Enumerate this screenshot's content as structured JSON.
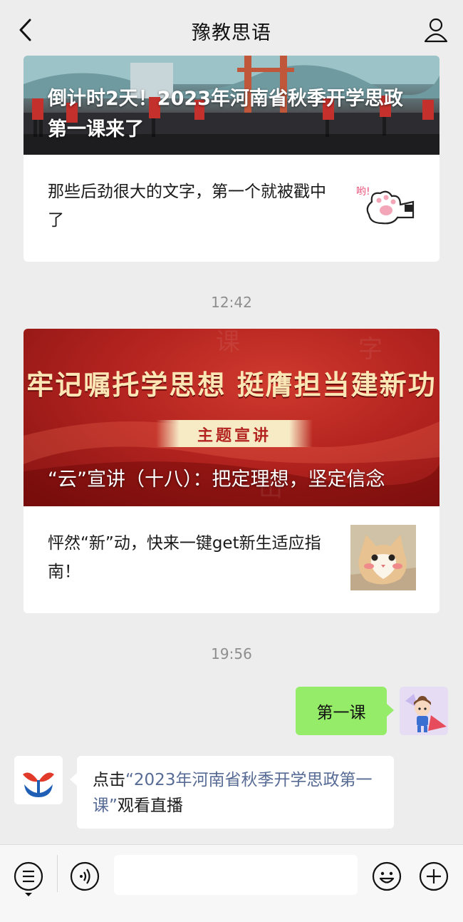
{
  "header": {
    "title": "豫教思语"
  },
  "articles": [
    {
      "cover_title": "倒计时2天！2023年河南省秋季开学思政第一课来了",
      "item_text": "那些后劲很大的文字，第一个就被戳中了"
    },
    {
      "cover_slogan": "牢记嘱托学思想 挺膺担当建新功",
      "cover_ribbon": "主题宣讲",
      "cover_title": "“云”宣讲（十八）：把定理想，坚定信念",
      "item_text": "怦然“新”动，快来一键get新生适应指南！"
    }
  ],
  "timestamps": [
    "12:42",
    "19:56"
  ],
  "messages": {
    "outgoing": "第一课",
    "incoming_prefix": "点击",
    "incoming_link": "“2023年河南省秋季开学思政第一课”",
    "incoming_suffix": "观看直播"
  },
  "sticker_text": "哟!",
  "colors": {
    "bubble_green": "#95ec69",
    "link_blue": "#576b95",
    "banner_red": "#b3231f"
  }
}
